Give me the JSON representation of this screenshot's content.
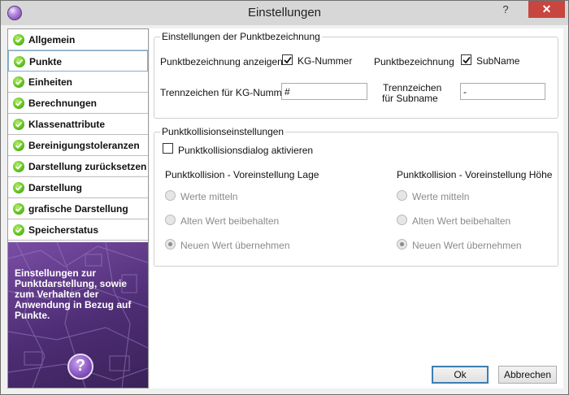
{
  "window": {
    "title": "Einstellungen"
  },
  "titlebar": {
    "help_label": "?",
    "close_label": "✕"
  },
  "sidebar": {
    "items": [
      {
        "label": "Allgemein"
      },
      {
        "label": "Punkte"
      },
      {
        "label": "Einheiten"
      },
      {
        "label": "Berechnungen"
      },
      {
        "label": "Klassenattribute"
      },
      {
        "label": "Bereinigungstoleranzen"
      },
      {
        "label": "Darstellung zurücksetzen"
      },
      {
        "label": "Darstellung"
      },
      {
        "label": "grafische Darstellung"
      },
      {
        "label": "Speicherstatus"
      }
    ],
    "active_index": 1,
    "description": "Einstellungen zur Punktdarstellung, sowie zum Verhalten der Anwendung in Bezug auf Punkte.",
    "help_label": "?"
  },
  "punktbezeichnung": {
    "title": "Einstellungen der Punktbezeichnung",
    "show_label": "Punktbezeichnung anzeigen",
    "kg_checkbox_label": "KG-Nummer",
    "kg_checked": true,
    "punktbez_label": "Punktbezeichnung",
    "subname_checkbox_label": "SubName",
    "subname_checked": true,
    "kg_sep_label": "Trennzeichen für KG-Nummer",
    "kg_sep_value": "#",
    "sub_sep_label_1": "Trennzeichen",
    "sub_sep_label_2": "für Subname",
    "sub_sep_value": "-"
  },
  "kollision": {
    "title": "Punktkollisionseinstellungen",
    "dialog_label": "Punktkollisionsdialog aktivieren",
    "dialog_checked": false,
    "lage_title": "Punktkollision - Voreinstellung Lage",
    "hoehe_title": "Punktkollision - Voreinstellung Höhe",
    "options": [
      "Werte mitteln",
      "Alten Wert beibehalten",
      "Neuen Wert übernehmen"
    ],
    "lage_selected": 2,
    "hoehe_selected": 2
  },
  "buttons": {
    "ok": "Ok",
    "cancel": "Abbrechen"
  },
  "colors": {
    "titlebar": "#d7d7d7",
    "close": "#c7463f",
    "side_panel": "#5a3585",
    "check_green": "#5fbf1f"
  }
}
